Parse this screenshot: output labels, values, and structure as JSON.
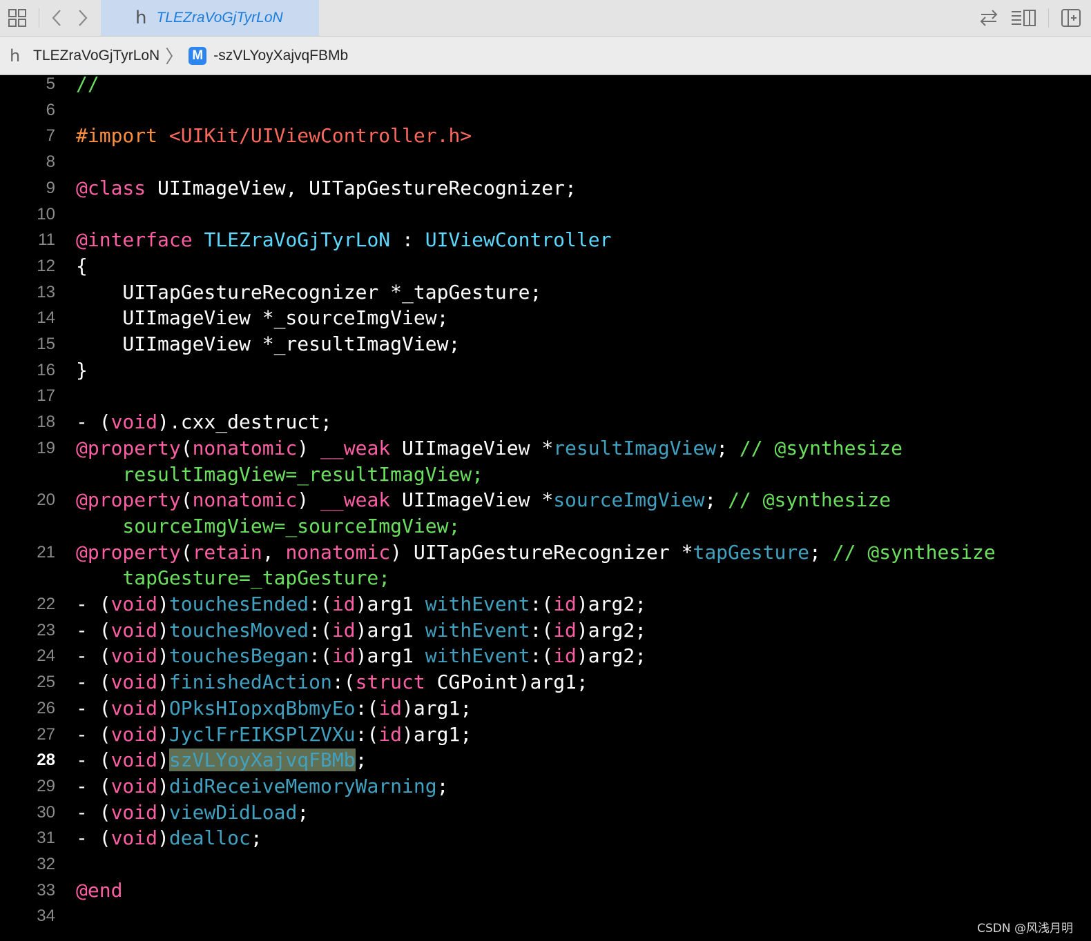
{
  "toolbar": {
    "grid_icon": "grid-icon",
    "back_icon": "chevron-left-icon",
    "forward_icon": "chevron-right-icon",
    "tab_glyph": "h",
    "tab_title": "TLEZraVoGjTyrLoN",
    "swap_icon": "swap-arrows-icon",
    "inspector_icon": "editor-layout-icon",
    "add_editor_icon": "add-editor-icon"
  },
  "breadcrumb": {
    "file_glyph": "h",
    "file": "TLEZraVoGjTyrLoN",
    "chevron": "〉",
    "badge": "M",
    "method": "-szVLYoyXajvqFBMb"
  },
  "editor": {
    "current_line": 28,
    "colors": {
      "keyword": "#fc5fa3",
      "preprocessor": "#fd8f3f",
      "string": "#fc6a5d",
      "comment": "#6bdf5e",
      "class": "#5dd8ff",
      "method": "#41a1c0",
      "selection": "#616f53"
    },
    "lines": [
      {
        "n": "5",
        "segs": [
          {
            "t": "//",
            "c": "cm"
          }
        ]
      },
      {
        "n": "6",
        "segs": []
      },
      {
        "n": "7",
        "segs": [
          {
            "t": "#import",
            "c": "pre"
          },
          {
            "t": " "
          },
          {
            "t": "<UIKit/UIViewController.h>",
            "c": "str"
          }
        ]
      },
      {
        "n": "8",
        "segs": []
      },
      {
        "n": "9",
        "segs": [
          {
            "t": "@class",
            "c": "kw"
          },
          {
            "t": " UIImageView, UITapGestureRecognizer;"
          }
        ]
      },
      {
        "n": "10",
        "segs": []
      },
      {
        "n": "11",
        "segs": [
          {
            "t": "@interface",
            "c": "kw"
          },
          {
            "t": " "
          },
          {
            "t": "TLEZraVoGjTyrLoN",
            "c": "cls"
          },
          {
            "t": " : "
          },
          {
            "t": "UIViewController",
            "c": "cls"
          }
        ]
      },
      {
        "n": "12",
        "segs": [
          {
            "t": "{"
          }
        ]
      },
      {
        "n": "13",
        "segs": [
          {
            "t": "    UITapGestureRecognizer *_tapGesture;"
          }
        ]
      },
      {
        "n": "14",
        "segs": [
          {
            "t": "    UIImageView *_sourceImgView;"
          }
        ]
      },
      {
        "n": "15",
        "segs": [
          {
            "t": "    UIImageView *_resultImagView;"
          }
        ]
      },
      {
        "n": "16",
        "segs": [
          {
            "t": "}"
          }
        ]
      },
      {
        "n": "17",
        "segs": []
      },
      {
        "n": "18",
        "segs": [
          {
            "t": "- ("
          },
          {
            "t": "void",
            "c": "kw"
          },
          {
            "t": ").cxx_destruct;"
          }
        ]
      },
      {
        "n": "19",
        "segs": [
          {
            "t": "@property",
            "c": "kw"
          },
          {
            "t": "("
          },
          {
            "t": "nonatomic",
            "c": "kw"
          },
          {
            "t": ") "
          },
          {
            "t": "__weak",
            "c": "kw"
          },
          {
            "t": " UIImageView *"
          },
          {
            "t": "resultImagView",
            "c": "meth"
          },
          {
            "t": "; "
          },
          {
            "t": "// @synthesize",
            "c": "cm"
          }
        ]
      },
      {
        "n": "",
        "segs": [
          {
            "t": "    resultImagView=_resultImagView;",
            "c": "cm"
          }
        ]
      },
      {
        "n": "20",
        "segs": [
          {
            "t": "@property",
            "c": "kw"
          },
          {
            "t": "("
          },
          {
            "t": "nonatomic",
            "c": "kw"
          },
          {
            "t": ") "
          },
          {
            "t": "__weak",
            "c": "kw"
          },
          {
            "t": " UIImageView *"
          },
          {
            "t": "sourceImgView",
            "c": "meth"
          },
          {
            "t": "; "
          },
          {
            "t": "// @synthesize",
            "c": "cm"
          }
        ]
      },
      {
        "n": "",
        "segs": [
          {
            "t": "    sourceImgView=_sourceImgView;",
            "c": "cm"
          }
        ]
      },
      {
        "n": "21",
        "segs": [
          {
            "t": "@property",
            "c": "kw"
          },
          {
            "t": "("
          },
          {
            "t": "retain",
            "c": "kw"
          },
          {
            "t": ", "
          },
          {
            "t": "nonatomic",
            "c": "kw"
          },
          {
            "t": ") UITapGestureRecognizer *"
          },
          {
            "t": "tapGesture",
            "c": "meth"
          },
          {
            "t": "; "
          },
          {
            "t": "// @synthesize",
            "c": "cm"
          }
        ]
      },
      {
        "n": "",
        "segs": [
          {
            "t": "    tapGesture=_tapGesture;",
            "c": "cm"
          }
        ]
      },
      {
        "n": "22",
        "segs": [
          {
            "t": "- ("
          },
          {
            "t": "void",
            "c": "kw"
          },
          {
            "t": ")"
          },
          {
            "t": "touchesEnded",
            "c": "meth"
          },
          {
            "t": ":("
          },
          {
            "t": "id",
            "c": "kw"
          },
          {
            "t": ")arg1 "
          },
          {
            "t": "withEvent",
            "c": "meth"
          },
          {
            "t": ":("
          },
          {
            "t": "id",
            "c": "kw"
          },
          {
            "t": ")arg2;"
          }
        ]
      },
      {
        "n": "23",
        "segs": [
          {
            "t": "- ("
          },
          {
            "t": "void",
            "c": "kw"
          },
          {
            "t": ")"
          },
          {
            "t": "touchesMoved",
            "c": "meth"
          },
          {
            "t": ":("
          },
          {
            "t": "id",
            "c": "kw"
          },
          {
            "t": ")arg1 "
          },
          {
            "t": "withEvent",
            "c": "meth"
          },
          {
            "t": ":("
          },
          {
            "t": "id",
            "c": "kw"
          },
          {
            "t": ")arg2;"
          }
        ]
      },
      {
        "n": "24",
        "segs": [
          {
            "t": "- ("
          },
          {
            "t": "void",
            "c": "kw"
          },
          {
            "t": ")"
          },
          {
            "t": "touchesBegan",
            "c": "meth"
          },
          {
            "t": ":("
          },
          {
            "t": "id",
            "c": "kw"
          },
          {
            "t": ")arg1 "
          },
          {
            "t": "withEvent",
            "c": "meth"
          },
          {
            "t": ":("
          },
          {
            "t": "id",
            "c": "kw"
          },
          {
            "t": ")arg2;"
          }
        ]
      },
      {
        "n": "25",
        "segs": [
          {
            "t": "- ("
          },
          {
            "t": "void",
            "c": "kw"
          },
          {
            "t": ")"
          },
          {
            "t": "finishedAction",
            "c": "meth"
          },
          {
            "t": ":("
          },
          {
            "t": "struct",
            "c": "kw"
          },
          {
            "t": " CGPoint)arg1;"
          }
        ]
      },
      {
        "n": "26",
        "segs": [
          {
            "t": "- ("
          },
          {
            "t": "void",
            "c": "kw"
          },
          {
            "t": ")"
          },
          {
            "t": "OPksHIopxqBbmyEo",
            "c": "meth"
          },
          {
            "t": ":("
          },
          {
            "t": "id",
            "c": "kw"
          },
          {
            "t": ")arg1;"
          }
        ]
      },
      {
        "n": "27",
        "segs": [
          {
            "t": "- ("
          },
          {
            "t": "void",
            "c": "kw"
          },
          {
            "t": ")"
          },
          {
            "t": "JyclFrEIKSPlZVXu",
            "c": "meth"
          },
          {
            "t": ":("
          },
          {
            "t": "id",
            "c": "kw"
          },
          {
            "t": ")arg1;"
          }
        ]
      },
      {
        "n": "28",
        "segs": [
          {
            "t": "- ("
          },
          {
            "t": "void",
            "c": "kw"
          },
          {
            "t": ")"
          },
          {
            "t": "szVLYoyXajvqFBMb",
            "c": "meth sel"
          },
          {
            "t": ";"
          }
        ]
      },
      {
        "n": "29",
        "segs": [
          {
            "t": "- ("
          },
          {
            "t": "void",
            "c": "kw"
          },
          {
            "t": ")"
          },
          {
            "t": "didReceiveMemoryWarning",
            "c": "meth"
          },
          {
            "t": ";"
          }
        ]
      },
      {
        "n": "30",
        "segs": [
          {
            "t": "- ("
          },
          {
            "t": "void",
            "c": "kw"
          },
          {
            "t": ")"
          },
          {
            "t": "viewDidLoad",
            "c": "meth"
          },
          {
            "t": ";"
          }
        ]
      },
      {
        "n": "31",
        "segs": [
          {
            "t": "- ("
          },
          {
            "t": "void",
            "c": "kw"
          },
          {
            "t": ")"
          },
          {
            "t": "dealloc",
            "c": "meth"
          },
          {
            "t": ";"
          }
        ]
      },
      {
        "n": "32",
        "segs": []
      },
      {
        "n": "33",
        "segs": [
          {
            "t": "@end",
            "c": "kw"
          }
        ]
      },
      {
        "n": "34",
        "segs": []
      }
    ]
  },
  "watermark": "CSDN @风浅月明"
}
